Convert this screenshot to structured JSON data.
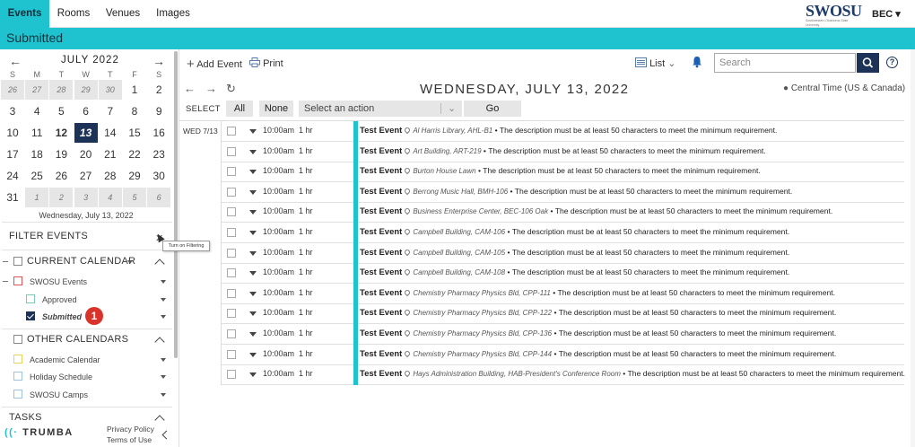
{
  "nav": {
    "tabs": [
      "Events",
      "Rooms",
      "Venues",
      "Images"
    ],
    "logo_text": "SWOSU",
    "logo_sub": "Southwestern Oklahoma State University",
    "user": "BEC ▾"
  },
  "title": "Submitted",
  "calendar": {
    "month": "JULY 2022",
    "dow": [
      "S",
      "M",
      "T",
      "W",
      "T",
      "F",
      "S"
    ],
    "weeks": [
      [
        "26",
        "27",
        "28",
        "29",
        "30",
        "1",
        "2"
      ],
      [
        "3",
        "4",
        "5",
        "6",
        "7",
        "8",
        "9"
      ],
      [
        "10",
        "11",
        "12",
        "13",
        "14",
        "15",
        "16"
      ],
      [
        "17",
        "18",
        "19",
        "20",
        "21",
        "22",
        "23"
      ],
      [
        "24",
        "25",
        "26",
        "27",
        "28",
        "29",
        "30"
      ],
      [
        "31",
        "1",
        "2",
        "3",
        "4",
        "5",
        "6"
      ]
    ],
    "selected_date_label": "Wednesday, July 13, 2022"
  },
  "filters": {
    "title": "FILTER EVENTS",
    "tooltip": "Turn on Filtering",
    "current_calendar": "CURRENT CALENDAR",
    "swosu_events": "SWOSU Events",
    "approved": "Approved",
    "submitted": "Submitted",
    "badge": "1",
    "other_calendars": "OTHER CALENDARS",
    "others": [
      "Academic Calendar",
      "Holiday Schedule",
      "SWOSU Camps"
    ],
    "tasks": "TASKS"
  },
  "footer": {
    "brand": "TRUMBA",
    "privacy": "Privacy Policy",
    "terms": "Terms of Use"
  },
  "toolbar": {
    "add_event": "Add Event",
    "print": "Print",
    "view": "List",
    "search_placeholder": "Search"
  },
  "day_header": {
    "date": "WEDNESDAY, JULY 13, 2022",
    "timezone": "Central Time (US & Canada)"
  },
  "select_bar": {
    "label": "SELECT",
    "all": "All",
    "none": "None",
    "action": "Select an action",
    "go": "Go"
  },
  "day_label": "WED 7/13",
  "events": [
    {
      "time": "10:00am",
      "duration": "1 hr",
      "title": "Test Event",
      "location": "Al Harris Library, AHL-B1",
      "desc": "The description must be at least 50 characters to meet the minimum requirement."
    },
    {
      "time": "10:00am",
      "duration": "1 hr",
      "title": "Test Event",
      "location": "Art Building, ART-219",
      "desc": "The description must be at least 50 characters to meet the minimum requirement."
    },
    {
      "time": "10:00am",
      "duration": "1 hr",
      "title": "Test Event",
      "location": "Burton House Lawn",
      "desc": "The description must be at least 50 characters to meet the minimum requirement."
    },
    {
      "time": "10:00am",
      "duration": "1 hr",
      "title": "Test Event",
      "location": "Berrong Music Hall, BMH-106",
      "desc": "The description must be at least 50 characters to meet the minimum requirement."
    },
    {
      "time": "10:00am",
      "duration": "1 hr",
      "title": "Test Event",
      "location": "Business Enterprise Center, BEC-106 Oak",
      "desc": "The description must be at least 50 characters to meet the minimum requirement."
    },
    {
      "time": "10:00am",
      "duration": "1 hr",
      "title": "Test Event",
      "location": "Campbell Building, CAM-106",
      "desc": "The description must be at least 50 characters to meet the minimum requirement."
    },
    {
      "time": "10:00am",
      "duration": "1 hr",
      "title": "Test Event",
      "location": "Campbell Building, CAM-105",
      "desc": "The description must be at least 50 characters to meet the minimum requirement."
    },
    {
      "time": "10:00am",
      "duration": "1 hr",
      "title": "Test Event",
      "location": "Campbell Building, CAM-108",
      "desc": "The description must be at least 50 characters to meet the minimum requirement."
    },
    {
      "time": "10:00am",
      "duration": "1 hr",
      "title": "Test Event",
      "location": "Chemistry Pharmacy Physics Bld, CPP-111",
      "desc": "The description must be at least 50 characters to meet the minimum requirement."
    },
    {
      "time": "10:00am",
      "duration": "1 hr",
      "title": "Test Event",
      "location": "Chemistry Pharmacy Physics Bld, CPP-122",
      "desc": "The description must be at least 50 characters to meet the minimum requirement."
    },
    {
      "time": "10:00am",
      "duration": "1 hr",
      "title": "Test Event",
      "location": "Chemistry Pharmacy Physics Bld, CPP-136",
      "desc": "The description must be at least 50 characters to meet the minimum requirement."
    },
    {
      "time": "10:00am",
      "duration": "1 hr",
      "title": "Test Event",
      "location": "Chemistry Pharmacy Physics Bld, CPP-144",
      "desc": "The description must be at least 50 characters to meet the minimum requirement."
    },
    {
      "time": "10:00am",
      "duration": "1 hr",
      "title": "Test Event",
      "location": "Hays Administration Building, HAB-President's Conference Room",
      "desc": "The description must be at least 50 characters to meet the minimum requirement."
    }
  ],
  "colors": {
    "accent": "#1fc3cf",
    "navy": "#1c3257",
    "badge": "#d9342b"
  }
}
